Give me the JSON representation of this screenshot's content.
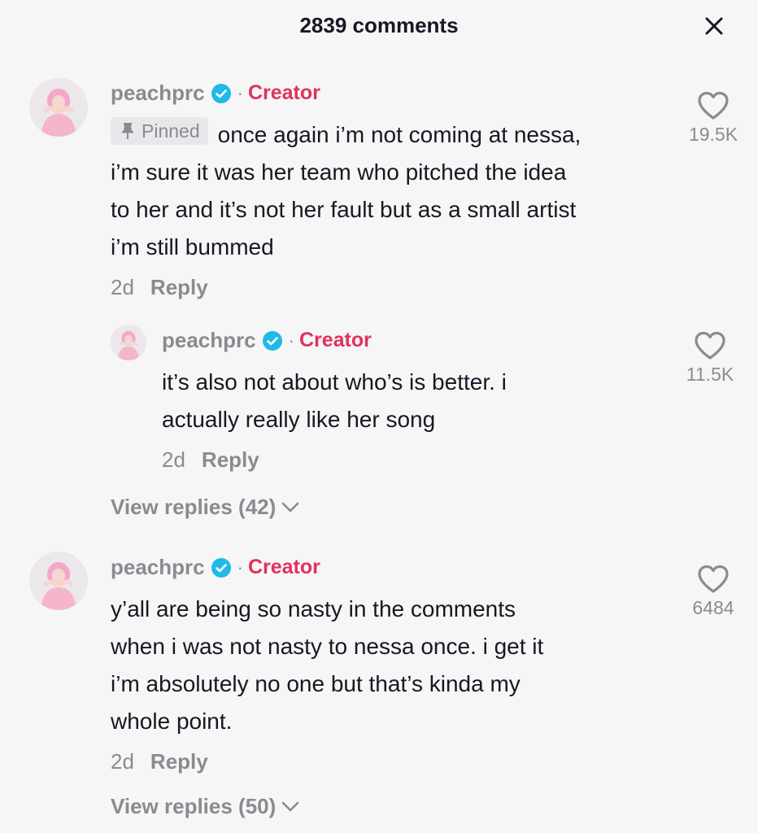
{
  "header": {
    "title": "2839 comments",
    "close_icon": "close-icon"
  },
  "colors": {
    "background": "#f6f6f6",
    "text": "#161823",
    "muted": "#8a8b91",
    "creator": "#e2315b",
    "verified": "#20b9e8"
  },
  "comments": [
    {
      "username": "peachprc",
      "separator": "·",
      "creator_label": "Creator",
      "pinned_label": "Pinned",
      "text": "once again i’m not coming at nessa,\ni’m sure it was her team who pitched the idea\nto her and it’s not her fault but as a small artist\ni’m still bummed",
      "time": "2d",
      "reply_label": "Reply",
      "likes": "19.5K"
    },
    {
      "username": "peachprc",
      "separator": "·",
      "creator_label": "Creator",
      "text": "it’s also not about who’s is better. i\nactually really like her song",
      "time": "2d",
      "reply_label": "Reply",
      "likes": "11.5K"
    },
    {
      "username": "peachprc",
      "separator": "·",
      "creator_label": "Creator",
      "text": "y’all are being so nasty in the comments\nwhen i was not nasty to nessa once. i get it\ni’m absolutely no one but that’s kinda my\nwhole point.",
      "time": "2d",
      "reply_label": "Reply",
      "likes": "6484"
    }
  ],
  "view_replies": [
    {
      "label": "View replies (42)"
    },
    {
      "label": "View replies (50)"
    }
  ]
}
